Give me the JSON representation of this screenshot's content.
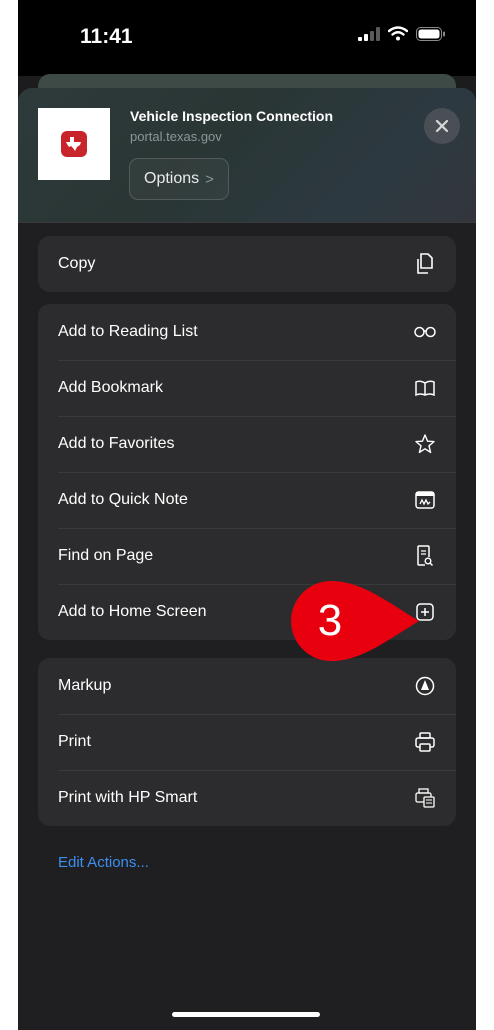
{
  "status_bar": {
    "time": "11:41"
  },
  "header": {
    "site_title": "Vehicle Inspection Connection",
    "site_url": "portal.texas.gov",
    "options_label": "Options",
    "options_chevron": ">"
  },
  "groups": [
    {
      "items": [
        {
          "label": "Copy",
          "icon": "copy-icon"
        }
      ]
    },
    {
      "items": [
        {
          "label": "Add to Reading List",
          "icon": "glasses-icon"
        },
        {
          "label": "Add Bookmark",
          "icon": "book-icon"
        },
        {
          "label": "Add to Favorites",
          "icon": "star-icon"
        },
        {
          "label": "Add to Quick Note",
          "icon": "quick-note-icon"
        },
        {
          "label": "Find on Page",
          "icon": "find-doc-icon"
        },
        {
          "label": "Add to Home Screen",
          "icon": "plus-square-icon"
        }
      ]
    },
    {
      "items": [
        {
          "label": "Markup",
          "icon": "markup-pen-icon"
        },
        {
          "label": "Print",
          "icon": "printer-icon"
        },
        {
          "label": "Print with HP Smart",
          "icon": "hp-printer-icon"
        }
      ]
    }
  ],
  "edit_actions": "Edit Actions...",
  "callout": {
    "text": "3",
    "color": "#e8000f"
  },
  "colors": {
    "accent_link": "#3c8ef0",
    "group_bg": "#2c2c2e",
    "sheet_bg": "#1f1f21"
  }
}
